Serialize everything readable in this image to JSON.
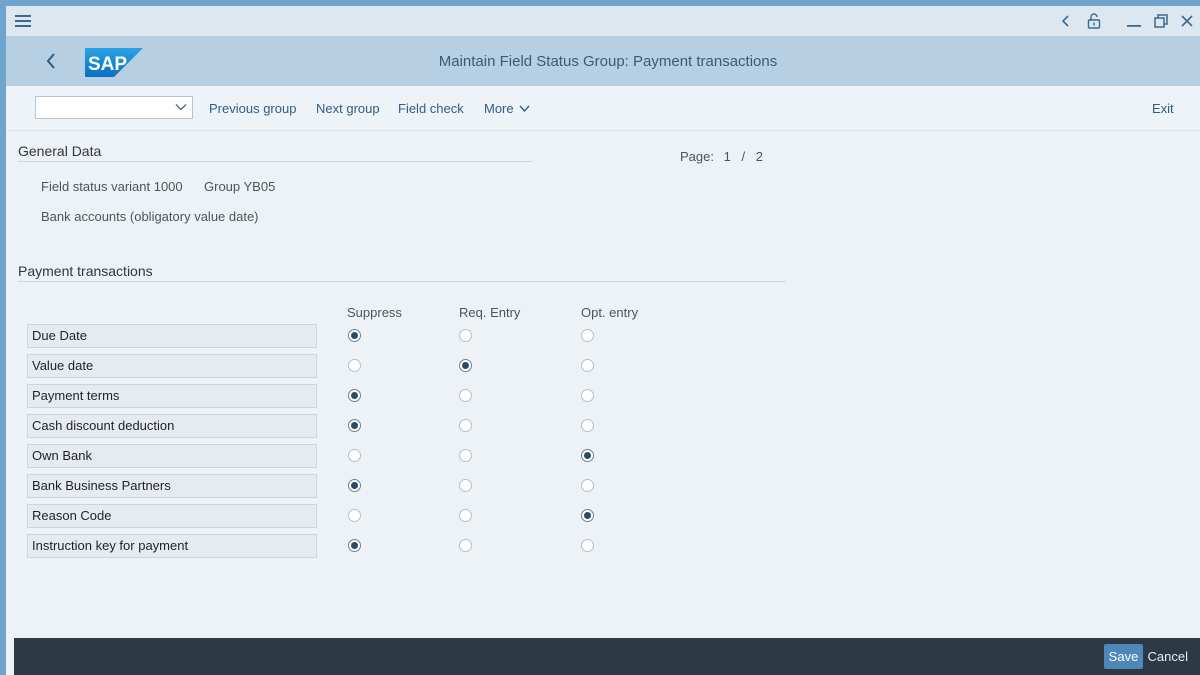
{
  "header": {
    "title": "Maintain Field Status Group: Payment transactions",
    "logo_text": "SAP"
  },
  "top_icons": [
    "menu-icon",
    "chevron-left-icon",
    "unlock-icon",
    "minimize-icon",
    "restore-icon",
    "close-icon"
  ],
  "toolbar": {
    "group_select_value": "",
    "previous_group": "Previous group",
    "next_group": "Next group",
    "field_check": "Field check",
    "more": "More",
    "exit": "Exit"
  },
  "general": {
    "title": "General Data",
    "variant": "Field status variant 1000",
    "group": "Group YB05",
    "description": "Bank accounts (obligatory value date)",
    "page_label": "Page:",
    "page_current": "1",
    "page_sep": "/",
    "page_total": "2"
  },
  "payment": {
    "title": "Payment transactions",
    "columns": [
      "Suppress",
      "Req. Entry",
      "Opt. entry"
    ],
    "rows": [
      {
        "label": "Due Date",
        "selected": 0
      },
      {
        "label": "Value date",
        "selected": 1
      },
      {
        "label": "Payment terms",
        "selected": 0
      },
      {
        "label": "Cash discount deduction",
        "selected": 0
      },
      {
        "label": "Own Bank",
        "selected": 2
      },
      {
        "label": "Bank Business Partners",
        "selected": 0
      },
      {
        "label": "Reason Code",
        "selected": 2
      },
      {
        "label": "Instruction key for payment",
        "selected": 0
      }
    ]
  },
  "footer": {
    "save": "Save",
    "cancel": "Cancel"
  },
  "colors": {
    "accent": "#4f87b8",
    "header_bg": "#b6cfe3",
    "footer_bg": "#2c3a45"
  }
}
